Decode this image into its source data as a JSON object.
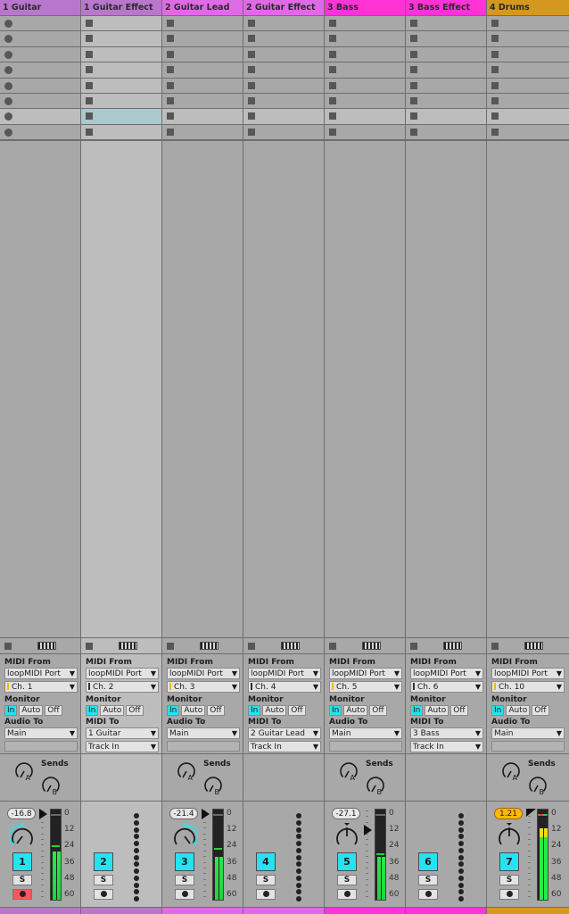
{
  "tracks": [
    {
      "name": "1 Guitar",
      "color": "#b877cc",
      "type": "midi",
      "light": false,
      "highlight_slot": 6,
      "slot_icon": "record-dot",
      "io": {
        "midi_from_label": "MIDI From",
        "midi_from": "loopMIDI Port",
        "channel": "Ch. 1",
        "channel_indicator": "yellow",
        "monitor_label": "Monitor",
        "monitor": [
          "In",
          "Auto",
          "Off"
        ],
        "monitor_active": "In",
        "out_label": "Audio To",
        "out": "Main",
        "out_sub": null
      },
      "sends": {
        "label": "Sends",
        "knobs": [
          "A",
          "B"
        ]
      },
      "mixer": {
        "volume": "-16.8",
        "volume_hot": false,
        "track_number": "1",
        "solo_label": "S",
        "arm_active": true,
        "pan_highlight": "left",
        "meter_level_db": -27,
        "meter_peak_db": -23,
        "fader_db": 0,
        "scale": [
          "0",
          "12",
          "24",
          "36",
          "48",
          "60"
        ]
      }
    },
    {
      "name": "1 Guitar Effect",
      "color": "#b877cc",
      "type": "midi-effect",
      "light": true,
      "highlight_slot": 6,
      "slot_icon": "stop-square",
      "io": {
        "midi_from_label": "MIDI From",
        "midi_from": "loopMIDI Port",
        "channel": "Ch. 2",
        "channel_indicator": "dark",
        "monitor_label": "Monitor",
        "monitor": [
          "In",
          "Auto",
          "Off"
        ],
        "monitor_active": "In",
        "out_label": "MIDI To",
        "out": "1 Guitar",
        "out_sub": "Track In"
      },
      "sends": null,
      "mixer": {
        "track_number": "2",
        "solo_label": "S",
        "arm_active": false
      }
    },
    {
      "name": "2 Guitar Lead",
      "color": "#e06ae6",
      "type": "midi",
      "light": false,
      "highlight_slot": 6,
      "slot_icon": "stop-square",
      "io": {
        "midi_from_label": "MIDI From",
        "midi_from": "loopMIDI Port",
        "channel": "Ch. 3",
        "channel_indicator": "yellow",
        "monitor_label": "Monitor",
        "monitor": [
          "In",
          "Auto",
          "Off"
        ],
        "monitor_active": "In",
        "out_label": "Audio To",
        "out": "Main",
        "out_sub": null
      },
      "sends": {
        "label": "Sends",
        "knobs": [
          "A",
          "B"
        ]
      },
      "mixer": {
        "volume": "-21.4",
        "volume_hot": false,
        "track_number": "3",
        "solo_label": "S",
        "arm_active": false,
        "pan_highlight": "right",
        "meter_level_db": -31,
        "meter_peak_db": -25,
        "fader_db": 0,
        "scale": [
          "0",
          "12",
          "24",
          "36",
          "48",
          "60"
        ]
      }
    },
    {
      "name": "2 Guitar Effect",
      "color": "#e06ae6",
      "type": "midi-effect",
      "light": false,
      "highlight_slot": 6,
      "slot_icon": "stop-square",
      "io": {
        "midi_from_label": "MIDI From",
        "midi_from": "loopMIDI Port",
        "channel": "Ch. 4",
        "channel_indicator": "dark",
        "monitor_label": "Monitor",
        "monitor": [
          "In",
          "Auto",
          "Off"
        ],
        "monitor_active": "In",
        "out_label": "MIDI To",
        "out": "2 Guitar Lead",
        "out_sub": "Track In"
      },
      "sends": null,
      "mixer": {
        "track_number": "4",
        "solo_label": "S",
        "arm_active": false
      }
    },
    {
      "name": "3 Bass",
      "color": "#ff33d6",
      "type": "midi",
      "light": false,
      "highlight_slot": 6,
      "slot_icon": "stop-square",
      "io": {
        "midi_from_label": "MIDI From",
        "midi_from": "loopMIDI Port",
        "channel": "Ch. 5",
        "channel_indicator": "yellow",
        "monitor_label": "Monitor",
        "monitor": [
          "In",
          "Auto",
          "Off"
        ],
        "monitor_active": "In",
        "out_label": "Audio To",
        "out": "Main",
        "out_sub": null
      },
      "sends": {
        "label": "Sends",
        "knobs": [
          "A",
          "B"
        ]
      },
      "mixer": {
        "volume": "-27.1",
        "volume_hot": false,
        "track_number": "5",
        "solo_label": "S",
        "arm_active": false,
        "pan_highlight": "center",
        "meter_level_db": -31,
        "meter_peak_db": -29,
        "fader_db": -12,
        "scale": [
          "0",
          "12",
          "24",
          "36",
          "48",
          "60"
        ]
      }
    },
    {
      "name": "3 Bass Effect",
      "color": "#ff33d6",
      "type": "midi-effect",
      "light": false,
      "highlight_slot": 6,
      "slot_icon": "stop-square",
      "io": {
        "midi_from_label": "MIDI From",
        "midi_from": "loopMIDI Port",
        "channel": "Ch. 6",
        "channel_indicator": "dark",
        "monitor_label": "Monitor",
        "monitor": [
          "In",
          "Auto",
          "Off"
        ],
        "monitor_active": "In",
        "out_label": "MIDI To",
        "out": "3 Bass",
        "out_sub": "Track In"
      },
      "sends": null,
      "mixer": {
        "track_number": "6",
        "solo_label": "S",
        "arm_active": false
      }
    },
    {
      "name": "4 Drums",
      "color": "#d4981f",
      "type": "midi",
      "light": false,
      "highlight_slot": 6,
      "slot_icon": "stop-square",
      "io": {
        "midi_from_label": "MIDI From",
        "midi_from": "loopMIDI Port",
        "channel": "Ch. 10",
        "channel_indicator": "yellow",
        "monitor_label": "Monitor",
        "monitor": [
          "In",
          "Auto",
          "Off"
        ],
        "monitor_active": "In",
        "out_label": "Audio To",
        "out": "Main",
        "out_sub": null
      },
      "sends": {
        "label": "Sends",
        "knobs": [
          "A",
          "B"
        ]
      },
      "mixer": {
        "volume": "1.21",
        "volume_hot": true,
        "track_number": "7",
        "solo_label": "S",
        "arm_active": false,
        "pan_highlight": "center",
        "meter_level_db": -10,
        "meter_peak_db": 0,
        "fader_db": 0,
        "clip": true,
        "scale": [
          "0",
          "12",
          "24",
          "36",
          "48",
          "60"
        ]
      }
    }
  ],
  "slot_count": 8,
  "colors": {
    "monitor_active": "#27e2f0",
    "track_number": "#27e2f0",
    "arm_active": "#ff5656",
    "meter_green": "#2be84a",
    "volume_hot": "#ffb80a",
    "selected_slot": "#a9c9cc"
  }
}
